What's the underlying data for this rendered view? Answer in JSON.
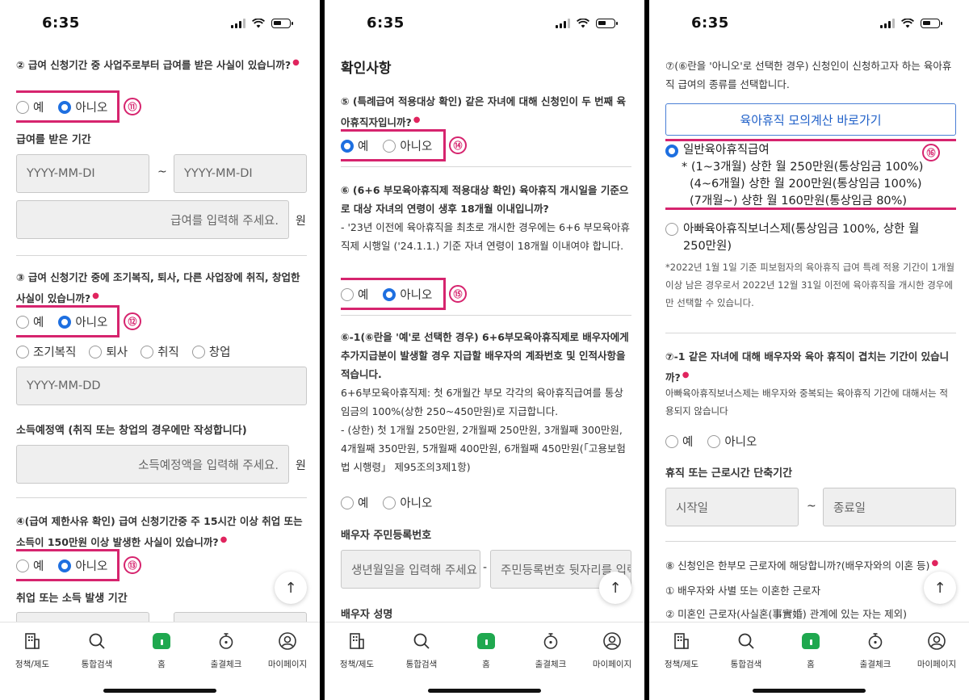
{
  "status": {
    "time": "6:35"
  },
  "nav": [
    {
      "label": "정책/제도",
      "icon": "building-icon"
    },
    {
      "label": "통합검색",
      "icon": "search-icon"
    },
    {
      "label": "홈",
      "icon": "home-icon"
    },
    {
      "label": "출결체크",
      "icon": "timer-icon"
    },
    {
      "label": "마이페이지",
      "icon": "user-icon"
    }
  ],
  "p1": {
    "q2": "② 급여 신청기간 중 사업주로부터 급여를 받은 사실이 있습니까?",
    "yes": "예",
    "no": "아니오",
    "badge11": "⑪",
    "period_label": "급여를 받은 기간",
    "date_ph": "YYYY-MM-DI",
    "tilde": "~",
    "amount_ph": "급여를 입력해 주세요.",
    "won": "원",
    "q3": "③ 급여 신청기간 중에 조기복직, 퇴사, 다른 사업장에 취직, 창업한 사실이 있습니까?",
    "badge12": "⑫",
    "opt_early": "조기복직",
    "opt_quit": "퇴사",
    "opt_job": "취직",
    "opt_start": "창업",
    "date_full_ph": "YYYY-MM-DD",
    "income_label": "소득예정액 (취직 또는 창업의 경우에만 작성합니다)",
    "income_ph": "소득예정액을 입력해 주세요.",
    "q4": "④(급여 제한사유 확인) 급여 신청기간중 주 15시간 이상 취업 또는 소득이 150만원 이상 발생한 사실이 있습니까?",
    "badge13": "⑬",
    "job_period_label": "취업 또는 소득 발생 기간"
  },
  "p2": {
    "heading": "확인사항",
    "q5": "⑤ (특례급여 적용대상 확인) 같은 자녀에 대해 신청인이 두 번째 육아휴직자입니까?",
    "yes": "예",
    "no": "아니오",
    "badge14": "⑭",
    "q6": "⑥ (6+6 부모육아휴직제 적용대상 확인) 육아휴직 개시일을 기준으로 대상 자녀의 연령이 생후 18개월 이내입니까?",
    "q6_note": "- '23년 이전에 육아휴직을 최초로 개시한 경우에는 6+6 부모육아휴직제 시행일 ('24.1.1.) 기준 자녀 연령이 18개월 이내여야 합니다.",
    "badge15": "⑮",
    "q6_1": "⑥-1(⑥란을 '예'로 선택한 경우) 6+6부모육아휴직제로 배우자에게 추가지급분이 발생할 경우 지급할 배우자의 계좌번호 및 인적사항을 적습니다.",
    "q6_1_desc": "6+6부모육아휴직제: 첫 6개월간 부모 각각의 육아휴직급여를 통상임금의 100%(상한 250~450만원)로 지급합니다.",
    "q6_1_cap": "- (상한) 첫 1개월 250만원, 2개월째 250만원, 3개월째 300만원, 4개월째 350만원, 5개월째 400만원, 6개월째 450만원(「고용보험법 시행령」 제95조의3제1항)",
    "spouse_rrn_label": "배우자 주민등록번호",
    "birth_ph": "생년월일을 입력해 주세요",
    "dash": "-",
    "rrn_back_ph": "주민등록번호 뒷자리를 입력해 주세요",
    "spouse_name_label": "배우자 성명"
  },
  "p3": {
    "q7": "⑦(⑥란을 '아니오'로 선택한 경우) 신청인이 신청하고자 하는 육아휴직 급여의 종류를 선택합니다.",
    "calc_button": "육아휴직 모의계산 바로가기",
    "opt_general": "일반육아휴직급여",
    "general_l1": "* (1~3개월) 상한 월 250만원(통상임금 100%)",
    "general_l2": "(4~6개월) 상한 월 200만원(통상임금 100%)",
    "general_l3": "(7개월~) 상한 월 160만원(통상임금 80%)",
    "badge16": "⑯",
    "opt_daddy": "아빠육아휴직보너스제(통상임금 100%, 상한 월 250만원)",
    "daddy_note": "*2022년 1월 1일 기준 피보험자의 육아휴직 급여 특례 적용 기간이 1개월 이상 남은 경우로서 2022년 12월 31일 이전에 육아휴직을 개시한 경우에만 선택할 수 있습니다.",
    "q7_1": "⑦-1 같은 자녀에 대해 배우자와 육아 휴직이 겹치는 기간이 있습니까?",
    "q7_1_desc": "아빠육아휴직보너스제는 배우자와 중복되는 육아휴직 기간에 대해서는 적용되지 않습니다",
    "yes": "예",
    "no": "아니오",
    "reduce_label": "휴직 또는 근로시간 단축기간",
    "start_ph": "시작일",
    "tilde": "~",
    "end_ph": "종료일",
    "q8": "⑧ 신청인은 한부모 근로자에 해당합니까?(배우자와의 이혼 등)",
    "q8_1": "① 배우자와 사별 또는 이혼한 근로자",
    "q8_2": "② 미혼인 근로자(사실혼(事實婚) 관계에 있는 자는 제외)"
  }
}
